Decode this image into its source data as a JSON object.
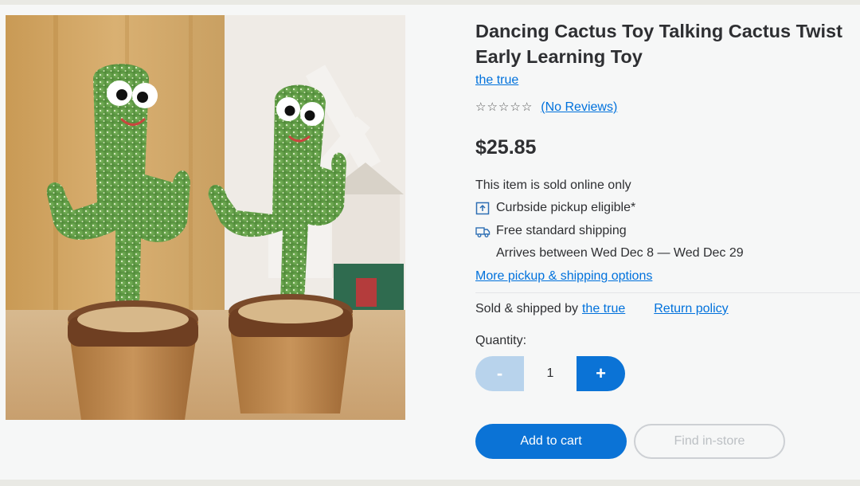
{
  "product": {
    "title": "Dancing Cactus Toy Talking Cactus Twist Early Learning Toy",
    "brand": "the true",
    "reviews_label": "(No Reviews)",
    "rating_stars": 0,
    "star_glyphs": [
      "☆",
      "☆",
      "☆",
      "☆",
      "☆"
    ],
    "price": "$25.85",
    "online_only": "This item is sold online only",
    "pickup": "Curbside pickup eligible*",
    "shipping": "Free standard shipping",
    "arrives": "Arrives between Wed Dec 8 — Wed Dec 29",
    "more_options": "More pickup & shipping options",
    "sold_by_prefix": "Sold & shipped by",
    "seller": "the true",
    "return_policy": "Return policy",
    "quantity_label": "Quantity:",
    "quantity": "1",
    "minus_label": "-",
    "plus_label": "+",
    "add_to_cart": "Add to cart",
    "find_in_store": "Find in-store"
  },
  "colors": {
    "accent": "#0b73d6",
    "link": "#0071dc",
    "disabled_minus": "#b8d3ec",
    "text": "#2e2f32"
  },
  "icons": {
    "pickup": "curbside-pickup-icon",
    "shipping": "delivery-truck-icon",
    "rating": "star-outline-icon"
  }
}
